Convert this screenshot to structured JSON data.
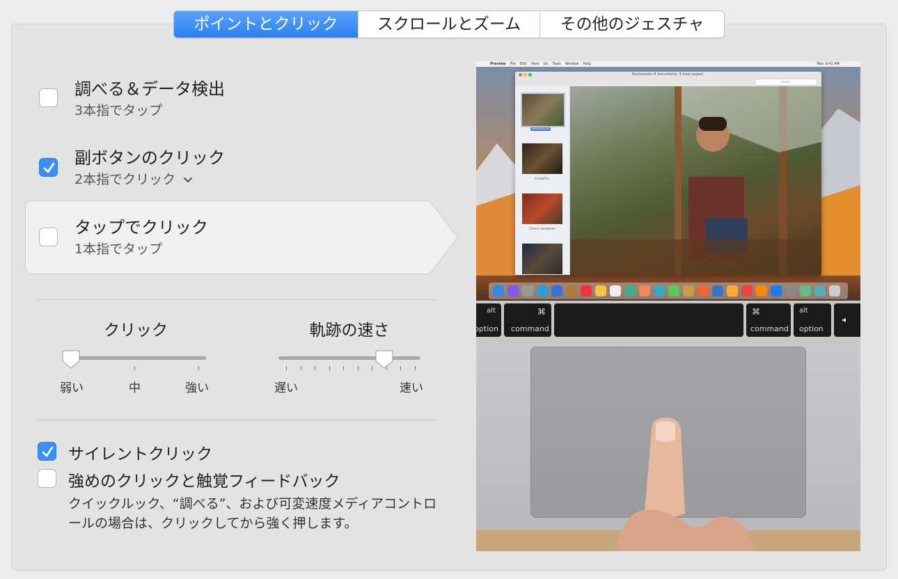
{
  "tabs": [
    {
      "label": "ポイントとクリック",
      "active": true
    },
    {
      "label": "スクロールとズーム",
      "active": false
    },
    {
      "label": "その他のジェスチャ",
      "active": false
    }
  ],
  "options": [
    {
      "title": "調べる＆データ検出",
      "subtitle": "3本指でタップ",
      "checked": false
    },
    {
      "title": "副ボタンのクリック",
      "subtitle": "2本指でクリック",
      "checked": true,
      "has_dropdown": true
    },
    {
      "title": "タップでクリック",
      "subtitle": "1本指でタップ",
      "checked": false
    }
  ],
  "click_slider": {
    "title": "クリック",
    "labels": [
      "弱い",
      "中",
      "強い"
    ],
    "level": 0
  },
  "tracking_slider": {
    "title": "軌跡の速さ",
    "labels": [
      "遅い",
      "速い"
    ],
    "level": 0.75
  },
  "silent_click": {
    "label": "サイレントクリック",
    "checked": true
  },
  "force_click": {
    "label": "強めのクリックと触覚フィードバック",
    "checked": false,
    "description": "クイックルック、“調べる”、および可変速度メディアコントロールの場合は、クリックしてから強く押します。"
  },
  "preview": {
    "menubar": [
      "Preview",
      "File",
      "Edit",
      "View",
      "Go",
      "Tools",
      "Window",
      "Help"
    ],
    "clock": "Mon 9:41 AM",
    "window_title": "Backwoods (4 documents, 4 total pages)",
    "search_placeholder": "Search",
    "thumbnails": [
      "Backwoods",
      "Campfire",
      "Cherry tomatoes"
    ],
    "keys": {
      "alt": "alt",
      "cmd_symbol": "⌘",
      "command": "command",
      "option": "option"
    }
  },
  "colors": {
    "accent": "#3a8ef6",
    "panel": "#e3e3e3"
  }
}
